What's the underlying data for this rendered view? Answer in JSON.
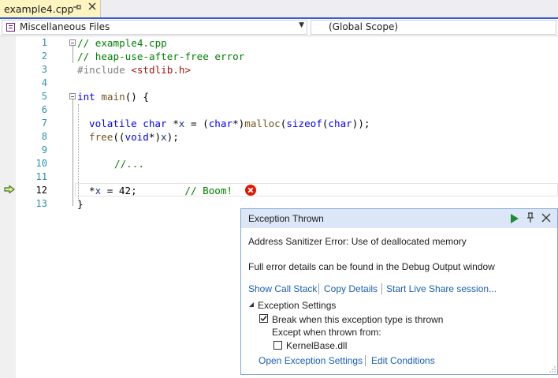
{
  "tab": {
    "title": "example4.cpp",
    "pin_glyph": "⊸",
    "close_glyph": "✕"
  },
  "navbar": {
    "project_scope": "Miscellaneous Files",
    "function_scope": "(Global Scope)"
  },
  "editor": {
    "line_numbers": [
      "1",
      "2",
      "3",
      "4",
      "5",
      "6",
      "7",
      "8",
      "9",
      "10",
      "11",
      "12",
      "13"
    ],
    "current_line": "12"
  },
  "code": {
    "l1_comment": "// example4.cpp",
    "l2_comment": "// heap-use-after-free error",
    "l3_include": "#include ",
    "l3_header": "<stdlib.h>",
    "l5_kw": "int",
    "l5_fn": "main",
    "l5_rest": "() {",
    "l7_kw1": "volatile",
    "l7_kw2": "char",
    "l7_p1": " *",
    "l7_var": "x",
    "l7_p2": " = (",
    "l7_kw3": "char",
    "l7_p3": "*)",
    "l7_fn": "malloc",
    "l7_p4": "(",
    "l7_kw4": "sizeof",
    "l7_p5": "(",
    "l7_kw5": "char",
    "l7_p6": "));",
    "l8_fn": "free",
    "l8_p1": "((",
    "l8_kw": "void",
    "l8_p2": "*)",
    "l8_var": "x",
    "l8_p3": ");",
    "l10_comment": "//...",
    "l12_p1": "*",
    "l12_var": "x",
    "l12_p2": " = 42;",
    "l12_comment": "// Boom!",
    "l13_brace": "}"
  },
  "popup": {
    "title": "Exception Thrown",
    "message": "Address Sanitizer Error: Use of deallocated memory",
    "details": "Full error details can be found in the Debug Output window",
    "links": [
      "Show Call Stack",
      "Copy Details",
      "Start Live Share session..."
    ],
    "settings_header": "Exception Settings",
    "break_label": "Break when this exception type is thrown",
    "break_checked": true,
    "except_label": "Except when thrown from:",
    "module_label": "KernelBase.dll",
    "module_checked": false,
    "footer_links": [
      "Open Exception Settings",
      "Edit Conditions"
    ]
  },
  "colors": {
    "keyword": "#0000ff",
    "comment": "#008000",
    "string": "#a31515",
    "line_number": "#2b91af",
    "error": "#e51400",
    "tab_active": "#fdf4bf",
    "popup_header": "#dbe7f7"
  }
}
